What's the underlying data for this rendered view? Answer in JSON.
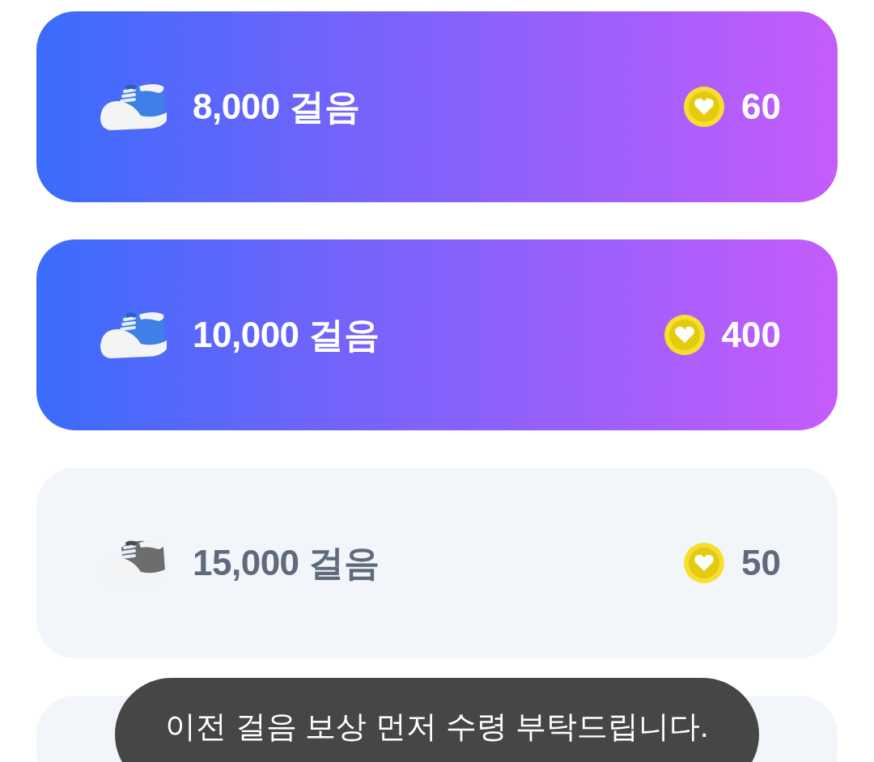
{
  "rewards": [
    {
      "steps": "8,000 걸음",
      "points": "60",
      "unlocked": true
    },
    {
      "steps": "10,000 걸음",
      "points": "400",
      "unlocked": true
    },
    {
      "steps": "15,000 걸음",
      "points": "50",
      "unlocked": false
    },
    {
      "unlocked": false
    }
  ],
  "toast": {
    "message": "이전 걸음 보상 먼저 수령 부탁드립니다."
  }
}
